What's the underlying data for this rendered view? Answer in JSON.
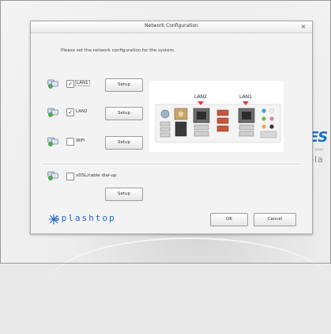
{
  "dialog": {
    "title": "Network Configuration",
    "close_glyph": "×",
    "instruction": "Please set the network configuration for the system."
  },
  "connections": [
    {
      "label": "LAN1",
      "checked": true,
      "check_glyph": "✓",
      "setup_label": "Setup",
      "icon": "network-connection-icon"
    },
    {
      "label": "LAN2",
      "checked": true,
      "check_glyph": "✓",
      "setup_label": "Setup",
      "icon": "network-connection-icon"
    },
    {
      "label": "WiFi",
      "checked": false,
      "check_glyph": "",
      "setup_label": "Setup",
      "icon": "network-connection-icon"
    },
    {
      "label": "xDSL/cable dial-up",
      "checked": false,
      "check_glyph": "",
      "setup_label": "Setup",
      "icon": "network-connection-icon"
    }
  ],
  "port_panel": {
    "lan2_label": "LAN2",
    "lan1_label": "LAN1",
    "indicator_color": "#e23b2e"
  },
  "footer": {
    "brand": "splashtop",
    "ok_label": "OK",
    "cancel_label": "Cancel"
  },
  "background": {
    "partial_brand_large": "ES",
    "partial_brand_small": "powe",
    "partial_brand_word": "pla",
    "accent_color": "#1e6fc7"
  }
}
